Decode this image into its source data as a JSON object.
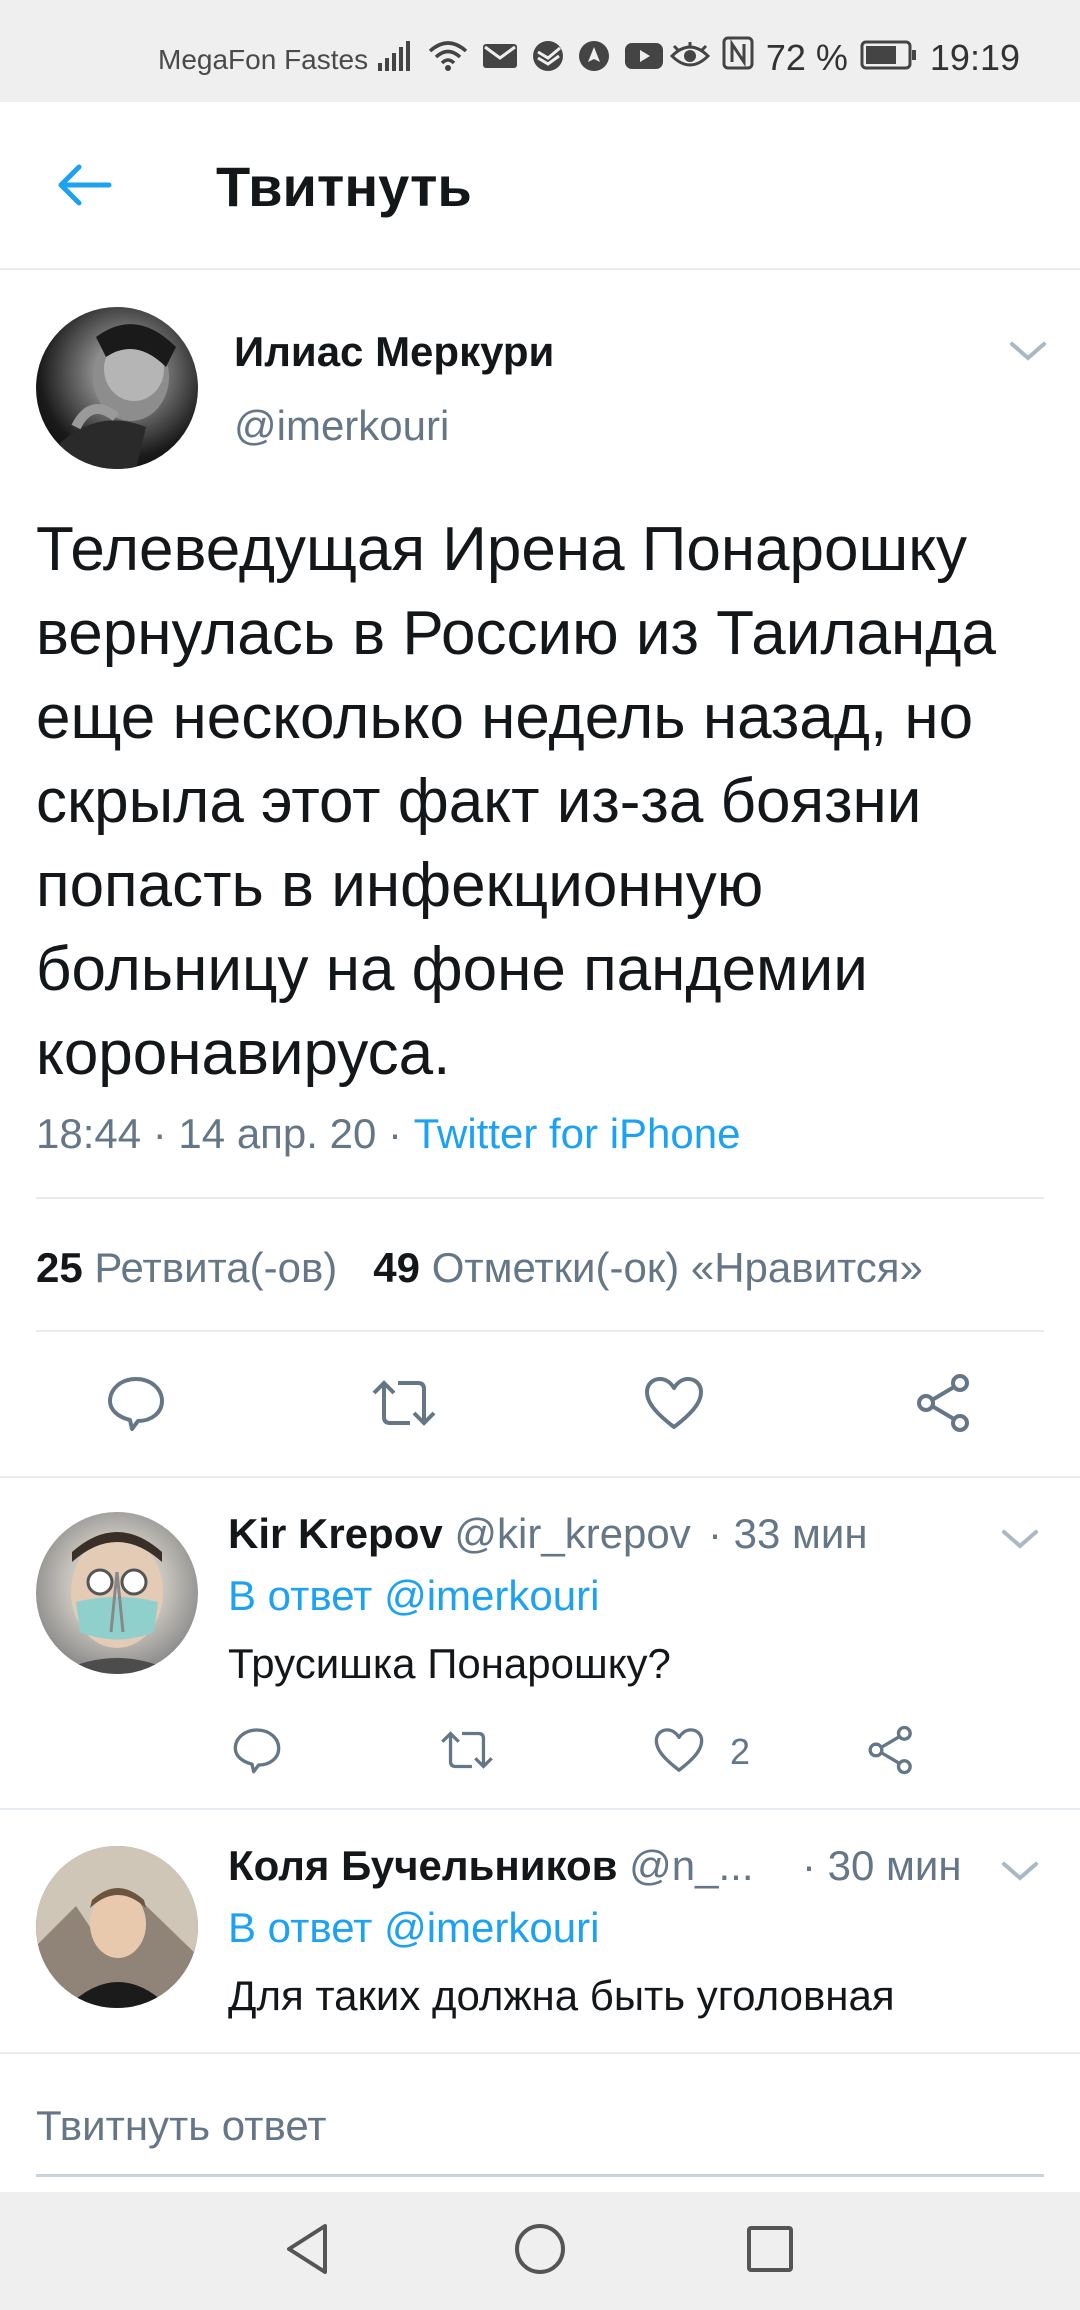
{
  "status_bar": {
    "carrier": "MegaFon Fastes",
    "battery": "72 %",
    "time": "19:19",
    "icons": [
      "signal-icon",
      "wifi-icon",
      "mail-icon",
      "sberbank-icon",
      "location-icon",
      "youtube-icon",
      "eye-icon",
      "nfc-icon",
      "battery-icon"
    ]
  },
  "header": {
    "title": "Твитнуть"
  },
  "tweet": {
    "author_name": "Илиас Меркури",
    "author_handle": "@imerkouri",
    "text": "Телеведущая Ирена Понарошку вернулась в Россию из Таиланда еще несколько недель назад, но скрыла этот факт из-за боязни попасть в инфекционную больницу на фоне пандемии коронавируса.",
    "time_date": "18:44 · 14 апр. 20 · ",
    "source": "Twitter for iPhone",
    "retweets_count": "25",
    "retweets_label": "Ретвита(-ов)",
    "likes_count": "49",
    "likes_label": "Отметки(-ок) «Нравится»"
  },
  "replies": [
    {
      "name": "Kir Krepov",
      "handle": "@kir_krepov",
      "time": "· 33 мин",
      "reply_prefix": "В ответ ",
      "reply_to": "@imerkouri",
      "text": "Трусишка Понарошку?",
      "like_count": "2"
    },
    {
      "name": "Коля Бучельников",
      "handle": "@n_...",
      "time": "· 30 мин",
      "reply_prefix": "В ответ ",
      "reply_to": "@imerkouri",
      "text": "Для таких должна быть уголовная"
    }
  ],
  "compose": {
    "placeholder": "Твитнуть ответ"
  },
  "colors": {
    "accent": "#1da1f2",
    "text": "#14171a",
    "secondary": "#657786",
    "divider": "#e6ecf0"
  }
}
